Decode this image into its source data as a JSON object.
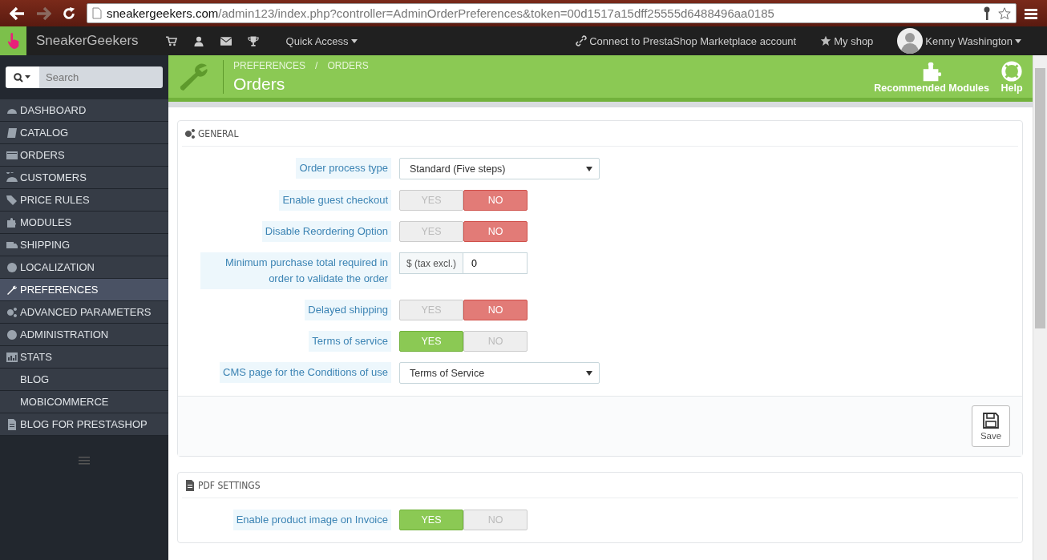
{
  "browser": {
    "url_host": "sneakergeekers.com",
    "url_path": "/admin123/index.php?controller=AdminOrderPreferences&token=00d1517a15dff25555d6488496aa0185"
  },
  "topbar": {
    "shop_name": "SneakerGeekers",
    "quick_access": "Quick Access",
    "marketplace": "Connect to PrestaShop Marketplace account",
    "my_shop": "My shop",
    "user": "Kenny Washington"
  },
  "sidebar": {
    "search_placeholder": "Search",
    "items": [
      {
        "label": "DASHBOARD",
        "selected": false
      },
      {
        "label": "CATALOG",
        "selected": false
      },
      {
        "label": "ORDERS",
        "selected": false
      },
      {
        "label": "CUSTOMERS",
        "selected": false
      },
      {
        "label": "PRICE RULES",
        "selected": false
      },
      {
        "label": "MODULES",
        "selected": false
      },
      {
        "label": "SHIPPING",
        "selected": false
      },
      {
        "label": "LOCALIZATION",
        "selected": false
      },
      {
        "label": "PREFERENCES",
        "selected": true
      },
      {
        "label": "ADVANCED PARAMETERS",
        "selected": false
      },
      {
        "label": "ADMINISTRATION",
        "selected": false
      },
      {
        "label": "STATS",
        "selected": false
      },
      {
        "label": "BLOG",
        "selected": false
      },
      {
        "label": "MOBICOMMERCE",
        "selected": false
      },
      {
        "label": "BLOG FOR PRESTASHOP",
        "selected": false
      }
    ]
  },
  "header": {
    "breadcrumb": [
      "PREFERENCES",
      "ORDERS"
    ],
    "breadcrumb_separator": "/",
    "title": "Orders",
    "actions": [
      "Recommended Modules",
      "Help"
    ]
  },
  "panels": [
    {
      "title": "GENERAL",
      "fields": [
        {
          "kind": "select",
          "label": "Order process type",
          "value": "Standard (Five steps)"
        },
        {
          "kind": "switch",
          "label": "Enable guest checkout",
          "yes": "YES",
          "no": "NO",
          "on": false
        },
        {
          "kind": "switch",
          "label": "Disable Reordering Option",
          "yes": "YES",
          "no": "NO",
          "on": false
        },
        {
          "kind": "money",
          "label": "Minimum purchase total required in order to validate the order",
          "prefix": "$ (tax excl.)",
          "value": "0"
        },
        {
          "kind": "switch",
          "label": "Delayed shipping",
          "yes": "YES",
          "no": "NO",
          "on": false
        },
        {
          "kind": "switch",
          "label": "Terms of service",
          "yes": "YES",
          "no": "NO",
          "on": true
        },
        {
          "kind": "select",
          "label": "CMS page for the Conditions of use",
          "value": "Terms of Service"
        }
      ],
      "save": "Save"
    },
    {
      "title": "PDF SETTINGS",
      "fields": [
        {
          "kind": "switch",
          "label": "Enable product image on Invoice",
          "yes": "YES",
          "no": "NO",
          "on": true
        }
      ]
    }
  ]
}
